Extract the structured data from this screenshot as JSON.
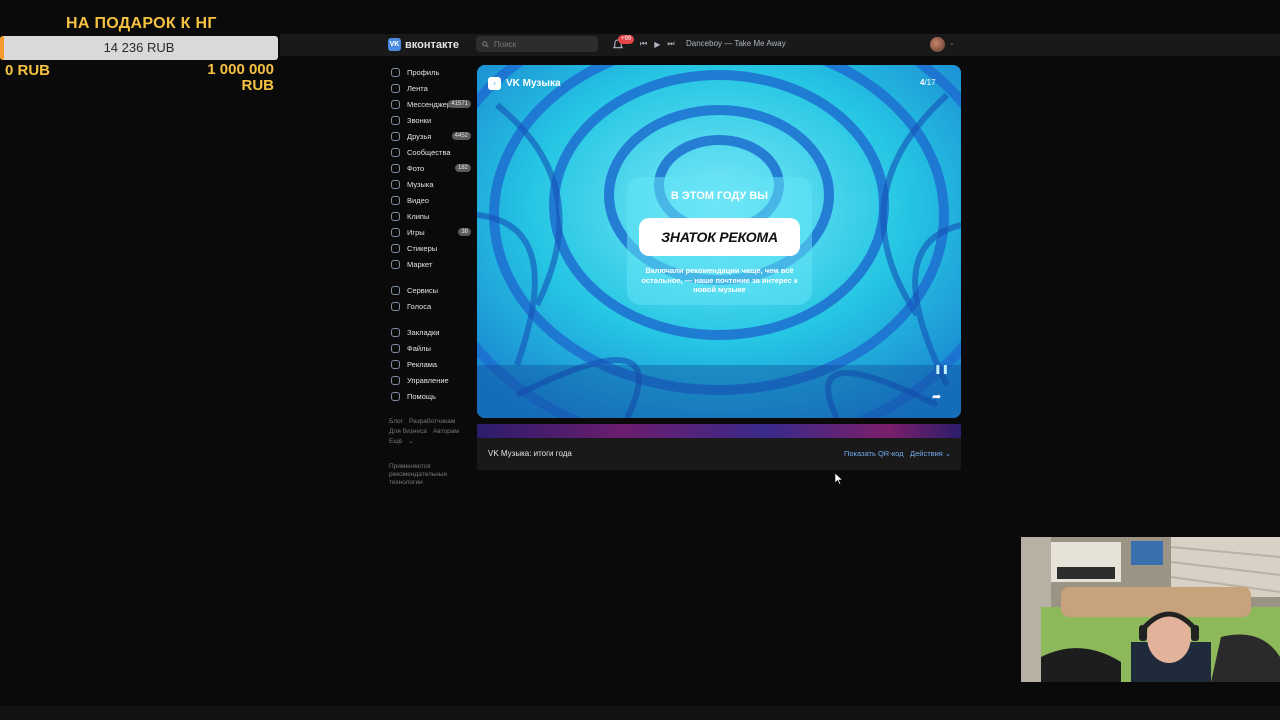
{
  "donation": {
    "title": "НА ПОДАРОК К НГ",
    "current": "14 236 RUB",
    "progress": 0.014236,
    "min": "0 RUB",
    "max_line1": "1 000 000",
    "max_line2": "RUB",
    "fill_color": "#f59a2c",
    "text_color": "#f5c242"
  },
  "header": {
    "logo": "вконтакте",
    "logo_mark": "VK",
    "search_placeholder": "Поиск",
    "notifications_badge": "+99",
    "track": "Danceboy — Take Me Away",
    "accent": "#4a8be0"
  },
  "menu": {
    "items": [
      {
        "label": "Профиль",
        "icon": "profile-icon"
      },
      {
        "label": "Лента",
        "icon": "news-icon"
      },
      {
        "label": "Мессенджер",
        "icon": "messenger-icon",
        "count": "41571"
      },
      {
        "label": "Звонки",
        "icon": "phone-icon"
      },
      {
        "label": "Друзья",
        "icon": "friends-icon",
        "count": "4452"
      },
      {
        "label": "Сообщества",
        "icon": "groups-icon"
      },
      {
        "label": "Фото",
        "icon": "photo-icon",
        "count": "182"
      },
      {
        "label": "Музыка",
        "icon": "music-icon"
      },
      {
        "label": "Видео",
        "icon": "video-icon"
      },
      {
        "label": "Клипы",
        "icon": "clips-icon"
      },
      {
        "label": "Игры",
        "icon": "games-icon",
        "count": "38"
      },
      {
        "label": "Стикеры",
        "icon": "stickers-icon"
      },
      {
        "label": "Маркет",
        "icon": "market-icon"
      }
    ],
    "items2": [
      {
        "label": "Сервисы",
        "icon": "services-icon"
      },
      {
        "label": "Голоса",
        "icon": "votes-icon"
      }
    ],
    "items3": [
      {
        "label": "Закладки",
        "icon": "bookmarks-icon"
      },
      {
        "label": "Файлы",
        "icon": "files-icon"
      },
      {
        "label": "Реклама",
        "icon": "ads-icon"
      },
      {
        "label": "Управление",
        "icon": "manage-icon"
      },
      {
        "label": "Помощь",
        "icon": "help-icon"
      }
    ]
  },
  "footer": {
    "blog": "Блог",
    "developers": "Разработчикам",
    "business": "Для бизнеса",
    "authors": "Авторам",
    "more": "Ещё",
    "reco_note": "Применяются рекомендательные технологии"
  },
  "story": {
    "source": "VK Музыка",
    "index": "4",
    "total": "/17",
    "heading": "В ЭТОМ ГОДУ ВЫ",
    "badge": "ЗНАТОК РЕКОМА",
    "description": "Включали рекомендации чаще, чем всё остальное, — наше почтение за интерес к новой музыке"
  },
  "post": {
    "title": "VK Музыка: итоги года",
    "qr": "Показать QR-код",
    "actions": "Действия"
  }
}
